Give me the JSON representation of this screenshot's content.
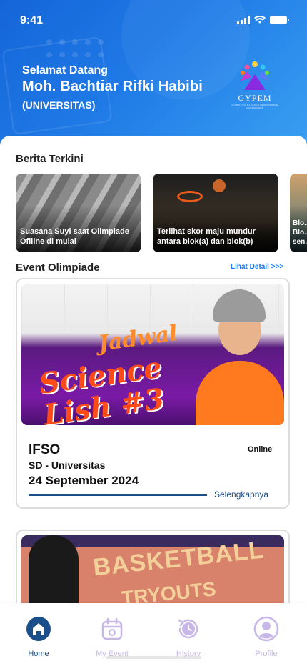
{
  "status_bar": {
    "time": "9:41"
  },
  "header": {
    "greeting": "Selamat Datang",
    "user_name": "Moh. Bachtiar Rifki Habibi",
    "role": "(UNIVERSITAS)",
    "logo_text": "GYPEM",
    "logo_subtext": "GLOBAL YOUTH ACTION PERFORMANCE MANAGEMENT"
  },
  "news": {
    "title": "Berita Terkini",
    "items": [
      {
        "caption": "Suasana Suyi saat Olimpiade Ofiline di mulai"
      },
      {
        "caption": "Terlihat skor maju mundur antara blok(a) dan blok(b)"
      },
      {
        "caption": "Blo... Blo... sen..."
      }
    ]
  },
  "events": {
    "title": "Event Olimpiade",
    "see_detail": "Lihat Detail >>>",
    "items": [
      {
        "banner_text": [
          "Jadwal",
          "Science",
          "Lish #3"
        ],
        "name": "IFSO",
        "mode": "Online",
        "level": "SD - Universitas",
        "date": "24 September 2024",
        "more_label": "Selengkapnya"
      },
      {
        "banner_text": [
          "BASKETBALL",
          "TRYOUTS"
        ]
      }
    ]
  },
  "bottom_nav": {
    "items": [
      {
        "label": "Home",
        "icon": "home-icon",
        "active": true
      },
      {
        "label": "My Event",
        "icon": "calendar-icon",
        "active": false
      },
      {
        "label": "History",
        "icon": "history-icon",
        "active": false
      },
      {
        "label": "Profile",
        "icon": "profile-icon",
        "active": false
      }
    ]
  },
  "colors": {
    "header_gradient_start": "#1565d8",
    "header_gradient_end": "#3aa0f2",
    "accent": "#1877f2",
    "nav_active": "#1b4f8b",
    "nav_inactive": "#c7b8e8"
  }
}
